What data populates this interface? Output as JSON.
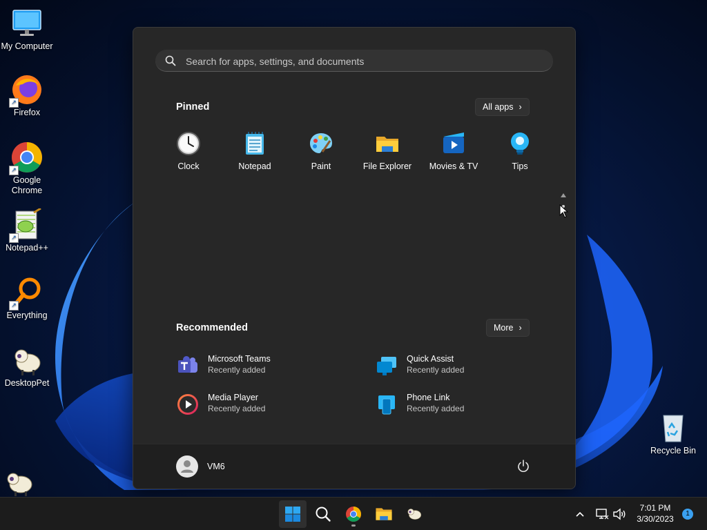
{
  "desktop": {
    "icons": [
      {
        "label": "My Computer"
      },
      {
        "label": "Firefox"
      },
      {
        "label": "Google Chrome"
      },
      {
        "label": "Notepad++"
      },
      {
        "label": "Everything"
      },
      {
        "label": "DesktopPet"
      },
      {
        "label": "Recycle Bin"
      }
    ]
  },
  "start_menu": {
    "search_placeholder": "Search for apps, settings, and documents",
    "pinned_title": "Pinned",
    "all_apps_label": "All apps",
    "pinned": [
      {
        "label": "Clock",
        "icon": "clock-icon"
      },
      {
        "label": "Notepad",
        "icon": "notepad-icon"
      },
      {
        "label": "Paint",
        "icon": "paint-icon"
      },
      {
        "label": "File Explorer",
        "icon": "folder-icon"
      },
      {
        "label": "Movies & TV",
        "icon": "movies-icon"
      },
      {
        "label": "Tips",
        "icon": "tips-icon"
      }
    ],
    "recommended_title": "Recommended",
    "more_label": "More",
    "recommended": [
      {
        "name": "Microsoft Teams",
        "sub": "Recently added",
        "icon": "teams-icon"
      },
      {
        "name": "Quick Assist",
        "sub": "Recently added",
        "icon": "quick-assist-icon"
      },
      {
        "name": "Media Player",
        "sub": "Recently added",
        "icon": "media-player-icon"
      },
      {
        "name": "Phone Link",
        "sub": "Recently added",
        "icon": "phone-link-icon"
      }
    ],
    "user_name": "VM6"
  },
  "taskbar": {
    "apps": [
      "start-icon",
      "search-icon",
      "chrome-icon",
      "file-explorer-icon",
      "desktoppet-icon"
    ],
    "time": "7:01 PM",
    "date": "3/30/2023",
    "notification_count": "1"
  },
  "colors": {
    "accent": "#0f7ad8",
    "menu_bg": "#272727",
    "taskbar_bg": "#1c1c1c"
  }
}
